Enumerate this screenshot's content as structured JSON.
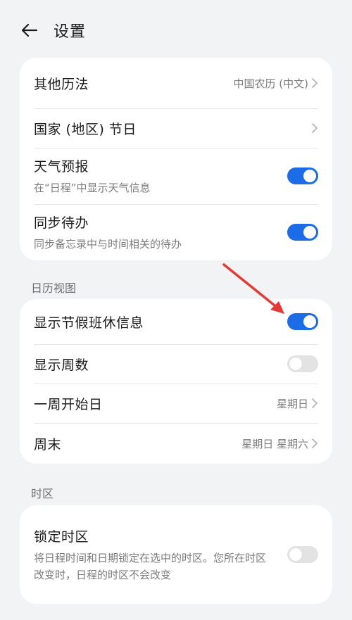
{
  "header": {
    "title": "设置",
    "back_icon": "arrow-left-icon"
  },
  "card1": {
    "rows": [
      {
        "title": "其他历法",
        "value": "中国农历 (中文)"
      },
      {
        "title": "国家 (地区) 节日"
      },
      {
        "title": "天气预报",
        "subtitle": "在“日程”中显示天气信息",
        "toggle": true
      },
      {
        "title": "同步待办",
        "subtitle": "同步备忘录中与时间相关的待办",
        "toggle": true
      }
    ]
  },
  "section_calendar_view": {
    "header": "日历视图",
    "rows": [
      {
        "title": "显示节假班休信息",
        "toggle": true
      },
      {
        "title": "显示周数",
        "toggle": false
      },
      {
        "title": "一周开始日",
        "value": "星期日"
      },
      {
        "title": "周末",
        "value": "星期日 星期六"
      }
    ]
  },
  "section_timezone": {
    "header": "时区",
    "rows": [
      {
        "title": "锁定时区",
        "subtitle": "将日程时间和日期锁定在选中的时区。您所在时区改变时，日程的时区不会改变",
        "toggle": false
      }
    ]
  },
  "colors": {
    "accent": "#1c6ce8",
    "annotation_arrow": "#e53935",
    "background": "#f1f3f5",
    "card": "#ffffff"
  }
}
